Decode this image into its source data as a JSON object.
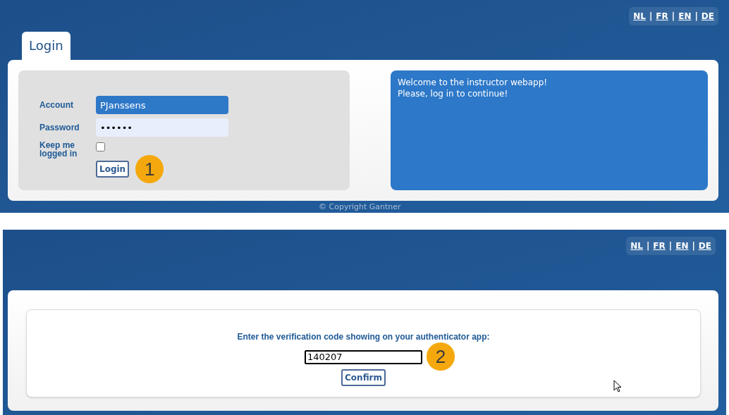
{
  "login_screen": {
    "languages": [
      {
        "label": "NL"
      },
      {
        "label": "FR"
      },
      {
        "label": "EN"
      },
      {
        "label": "DE"
      }
    ],
    "separator": "|",
    "tabs": [
      {
        "label": "Login",
        "selected": true
      }
    ],
    "fields": [
      {
        "label": "Account",
        "value": "PJanssens",
        "kind": "text",
        "autofilled": true
      },
      {
        "label": "Password",
        "value": "••••••",
        "kind": "password",
        "autofilled": false
      }
    ],
    "keep_logged_in": {
      "label": "Keep me logged in",
      "checked": false
    },
    "button": "Login",
    "step_badge": "1",
    "welcome_lines": [
      "Welcome to the instructor webapp!",
      "Please, log in to continue!"
    ],
    "footer": "© Copyright Gantner"
  },
  "verification_screen": {
    "languages": [
      {
        "label": "NL"
      },
      {
        "label": "FR"
      },
      {
        "label": "EN"
      },
      {
        "label": "DE"
      }
    ],
    "separator": "|",
    "prompt": "Enter the verification code showing on your authenticator app:",
    "code_value": "140207",
    "button": "Confirm",
    "step_badge": "2"
  }
}
